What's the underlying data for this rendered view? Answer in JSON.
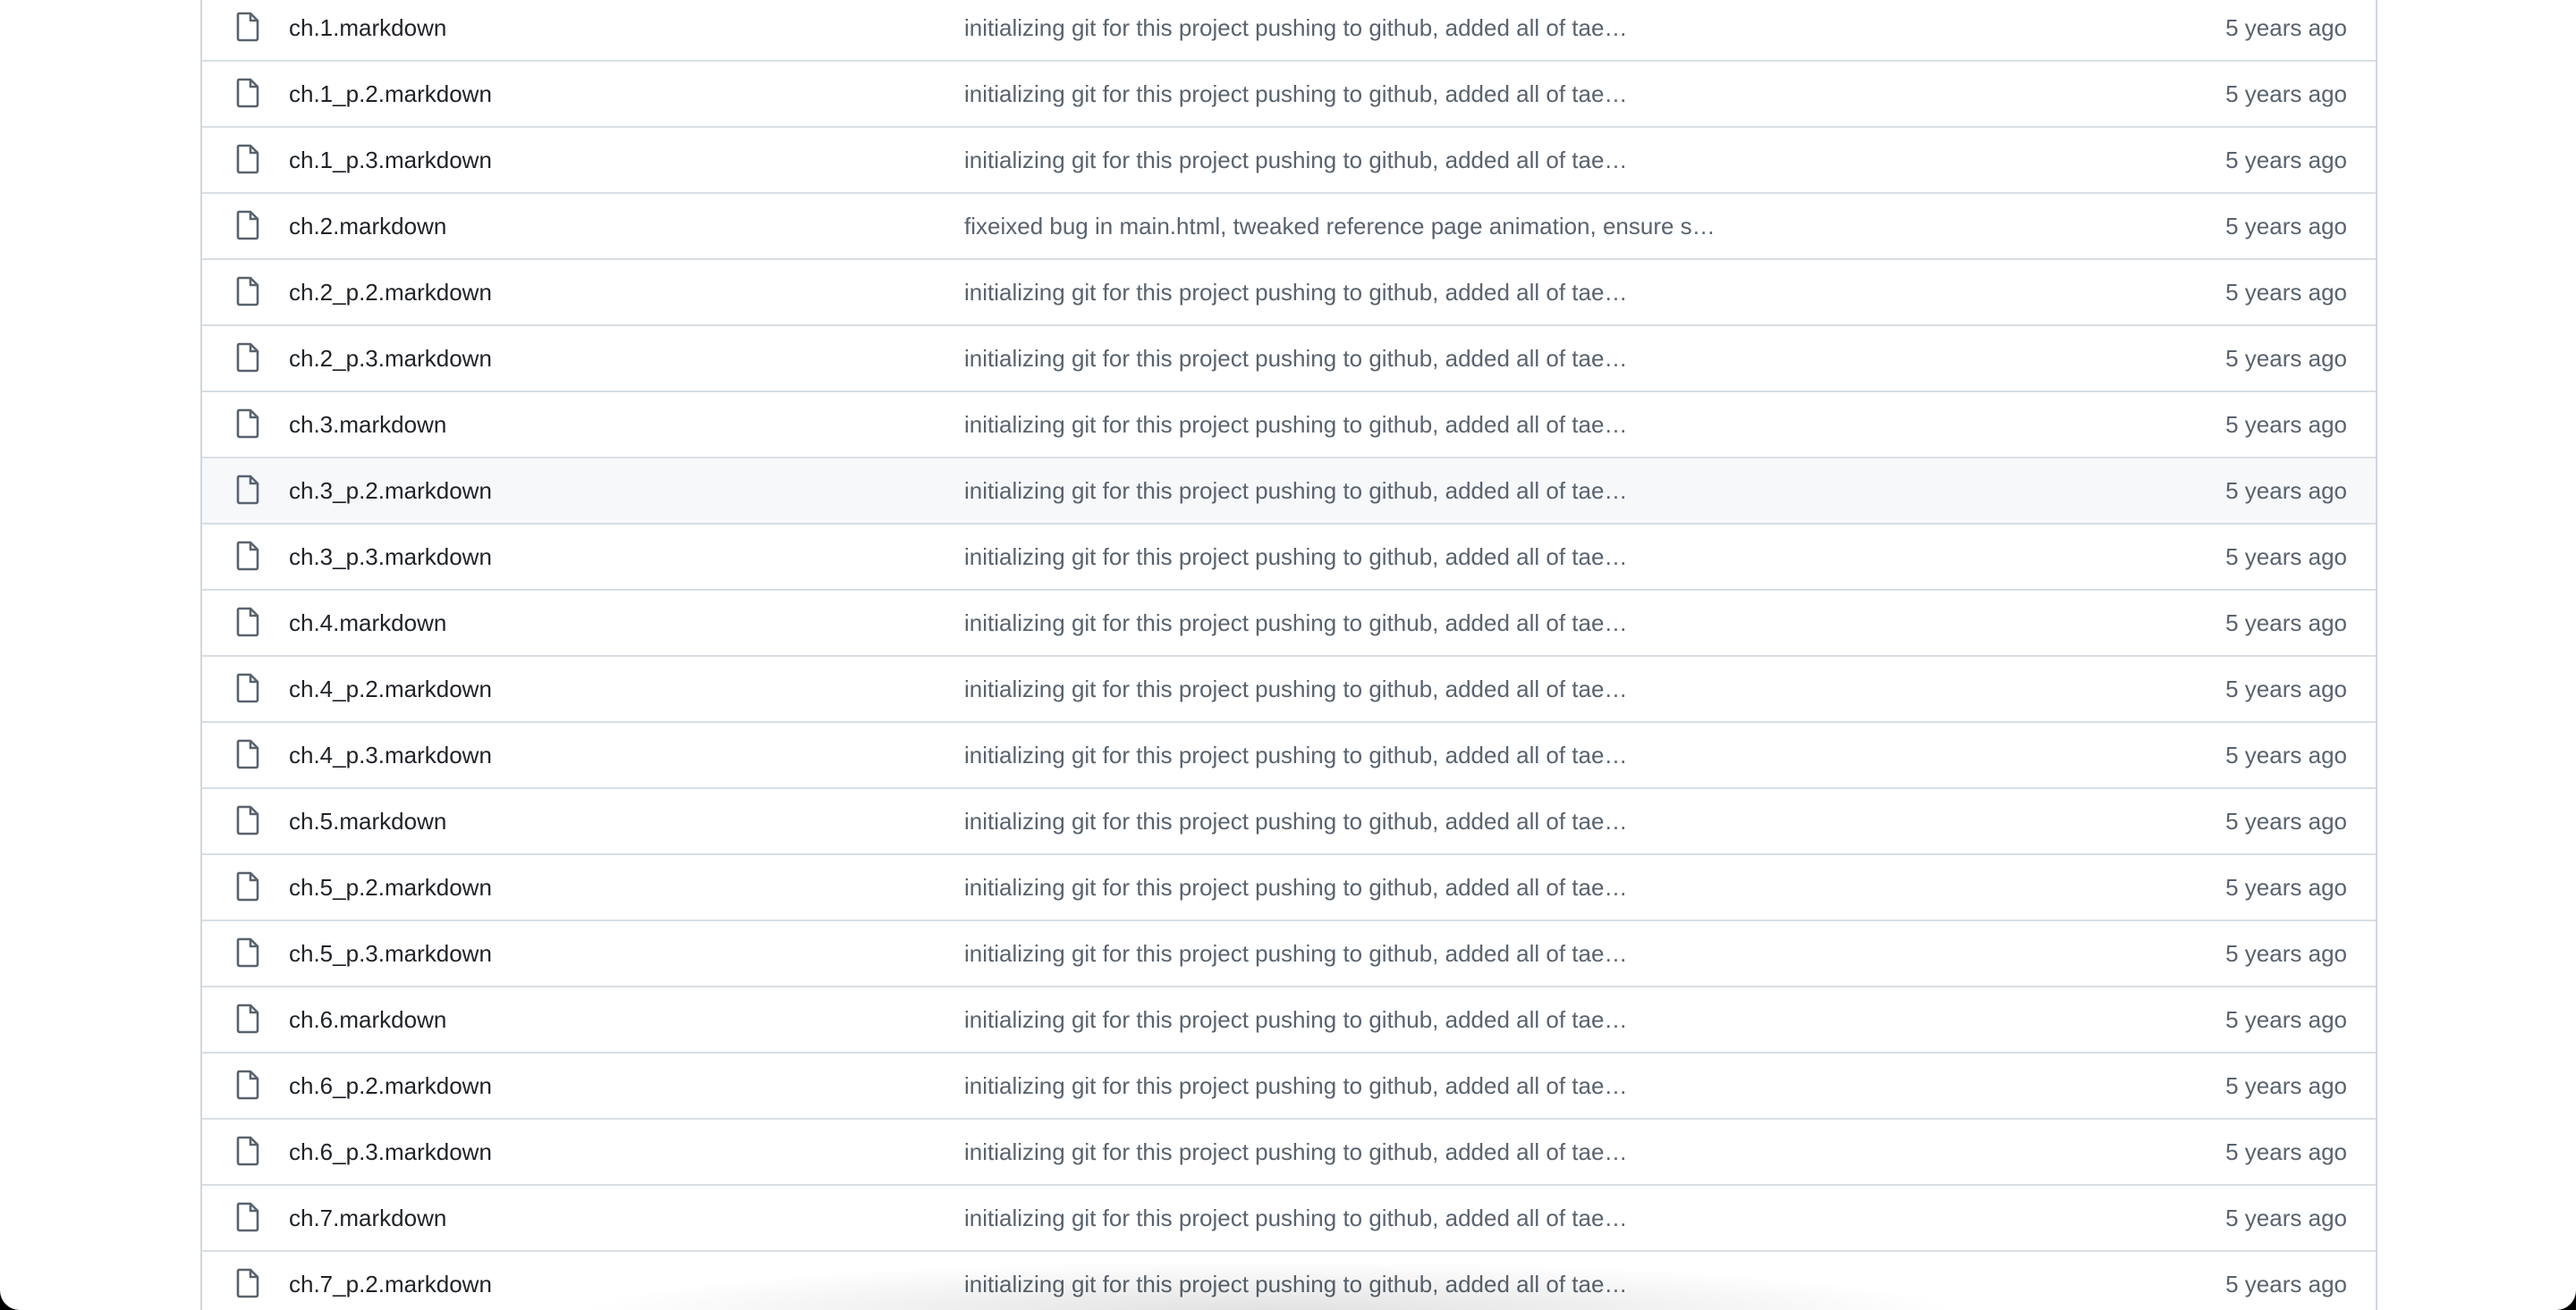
{
  "files": [
    {
      "name": "ch.1.markdown",
      "message": "initializing git for this project pushing to github, added all of tae…",
      "time": "5 years ago"
    },
    {
      "name": "ch.1_p.2.markdown",
      "message": "initializing git for this project pushing to github, added all of tae…",
      "time": "5 years ago"
    },
    {
      "name": "ch.1_p.3.markdown",
      "message": "initializing git for this project pushing to github, added all of tae…",
      "time": "5 years ago"
    },
    {
      "name": "ch.2.markdown",
      "message": "fixeixed bug in main.html, tweaked reference page animation, ensure s…",
      "time": "5 years ago"
    },
    {
      "name": "ch.2_p.2.markdown",
      "message": "initializing git for this project pushing to github, added all of tae…",
      "time": "5 years ago"
    },
    {
      "name": "ch.2_p.3.markdown",
      "message": "initializing git for this project pushing to github, added all of tae…",
      "time": "5 years ago"
    },
    {
      "name": "ch.3.markdown",
      "message": "initializing git for this project pushing to github, added all of tae…",
      "time": "5 years ago"
    },
    {
      "name": "ch.3_p.2.markdown",
      "message": "initializing git for this project pushing to github, added all of tae…",
      "time": "5 years ago"
    },
    {
      "name": "ch.3_p.3.markdown",
      "message": "initializing git for this project pushing to github, added all of tae…",
      "time": "5 years ago"
    },
    {
      "name": "ch.4.markdown",
      "message": "initializing git for this project pushing to github, added all of tae…",
      "time": "5 years ago"
    },
    {
      "name": "ch.4_p.2.markdown",
      "message": "initializing git for this project pushing to github, added all of tae…",
      "time": "5 years ago"
    },
    {
      "name": "ch.4_p.3.markdown",
      "message": "initializing git for this project pushing to github, added all of tae…",
      "time": "5 years ago"
    },
    {
      "name": "ch.5.markdown",
      "message": "initializing git for this project pushing to github, added all of tae…",
      "time": "5 years ago"
    },
    {
      "name": "ch.5_p.2.markdown",
      "message": "initializing git for this project pushing to github, added all of tae…",
      "time": "5 years ago"
    },
    {
      "name": "ch.5_p.3.markdown",
      "message": "initializing git for this project pushing to github, added all of tae…",
      "time": "5 years ago"
    },
    {
      "name": "ch.6.markdown",
      "message": "initializing git for this project pushing to github, added all of tae…",
      "time": "5 years ago"
    },
    {
      "name": "ch.6_p.2.markdown",
      "message": "initializing git for this project pushing to github, added all of tae…",
      "time": "5 years ago"
    },
    {
      "name": "ch.6_p.3.markdown",
      "message": "initializing git for this project pushing to github, added all of tae…",
      "time": "5 years ago"
    },
    {
      "name": "ch.7.markdown",
      "message": "initializing git for this project pushing to github, added all of tae…",
      "time": "5 years ago"
    },
    {
      "name": "ch.7_p.2.markdown",
      "message": "initializing git for this project pushing to github, added all of tae…",
      "time": "5 years ago"
    }
  ],
  "hovered_index": 7
}
